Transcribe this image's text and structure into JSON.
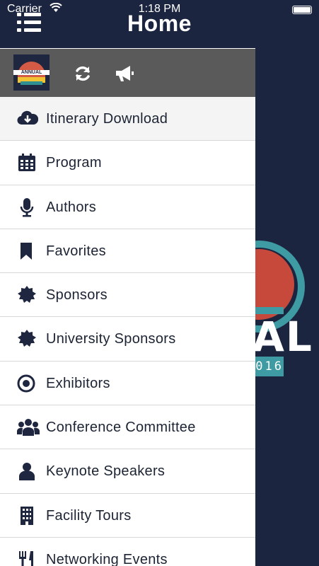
{
  "status": {
    "carrier": "Carrier",
    "time": "1:18 PM"
  },
  "header": {
    "title": "Home"
  },
  "background": {
    "logo_letters": "AL",
    "logo_year": "016"
  },
  "avatar": {
    "band_text": "ANNUAL"
  },
  "menu": {
    "items": [
      {
        "label": "Itinerary Download",
        "icon": "cloud-download-icon"
      },
      {
        "label": "Program",
        "icon": "calendar-icon"
      },
      {
        "label": "Authors",
        "icon": "microphone-icon"
      },
      {
        "label": "Favorites",
        "icon": "bookmark-icon"
      },
      {
        "label": "Sponsors",
        "icon": "badge-icon"
      },
      {
        "label": "University Sponsors",
        "icon": "badge-icon"
      },
      {
        "label": "Exhibitors",
        "icon": "target-icon"
      },
      {
        "label": "Conference Committee",
        "icon": "group-icon"
      },
      {
        "label": "Keynote Speakers",
        "icon": "user-icon"
      },
      {
        "label": "Facility Tours",
        "icon": "building-icon"
      },
      {
        "label": "Networking Events",
        "icon": "utensils-icon"
      }
    ]
  },
  "colors": {
    "nav": "#1c2540",
    "drawer_top": "#5a5a5a",
    "icon": "#1e2640",
    "accent_teal": "#3e9aa3",
    "accent_red": "#c7493c"
  }
}
